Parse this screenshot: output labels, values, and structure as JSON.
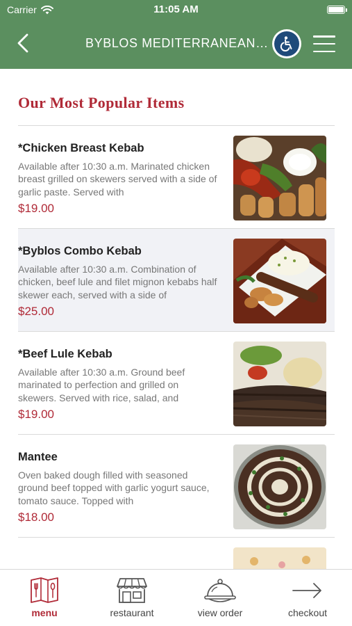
{
  "status_bar": {
    "carrier": "Carrier",
    "time": "11:05 AM"
  },
  "nav": {
    "title": "BYBLOS MEDITERRANEAN B...",
    "back_icon": "chevron-left-icon",
    "accessibility_icon": "wheelchair-icon",
    "menu_icon": "hamburger-icon"
  },
  "section": {
    "title": "Our Most Popular Items"
  },
  "items": [
    {
      "name": "*Chicken Breast Kebab",
      "description": "Available after 10:30 a.m. Marinated chicken breast grilled on skewers served with a side of garlic paste. Served with",
      "price": "$19.00"
    },
    {
      "name": "*Byblos Combo Kebab",
      "description": "Available after 10:30 a.m. Combination of chicken, beef lule and filet mignon kebabs half skewer each, served with a side of",
      "price": "$25.00"
    },
    {
      "name": "*Beef Lule Kebab",
      "description": "Available after 10:30 a.m. Ground beef marinated to perfection and grilled on skewers. Served with rice, salad, and",
      "price": "$19.00"
    },
    {
      "name": "Mantee",
      "description": "Oven baked dough filled with seasoned ground beef topped with garlic yogurt sauce, tomato sauce. Topped with",
      "price": "$18.00"
    }
  ],
  "tabs": [
    {
      "label": "menu",
      "icon": "menu-book-icon",
      "active": true
    },
    {
      "label": "restaurant",
      "icon": "storefront-icon",
      "active": false
    },
    {
      "label": "view order",
      "icon": "cloche-icon",
      "active": false
    },
    {
      "label": "checkout",
      "icon": "arrow-right-icon",
      "active": false
    }
  ],
  "colors": {
    "header_green": "#5b8f5f",
    "accent_red": "#b02a37",
    "accessibility_blue": "#1f4a7a"
  }
}
